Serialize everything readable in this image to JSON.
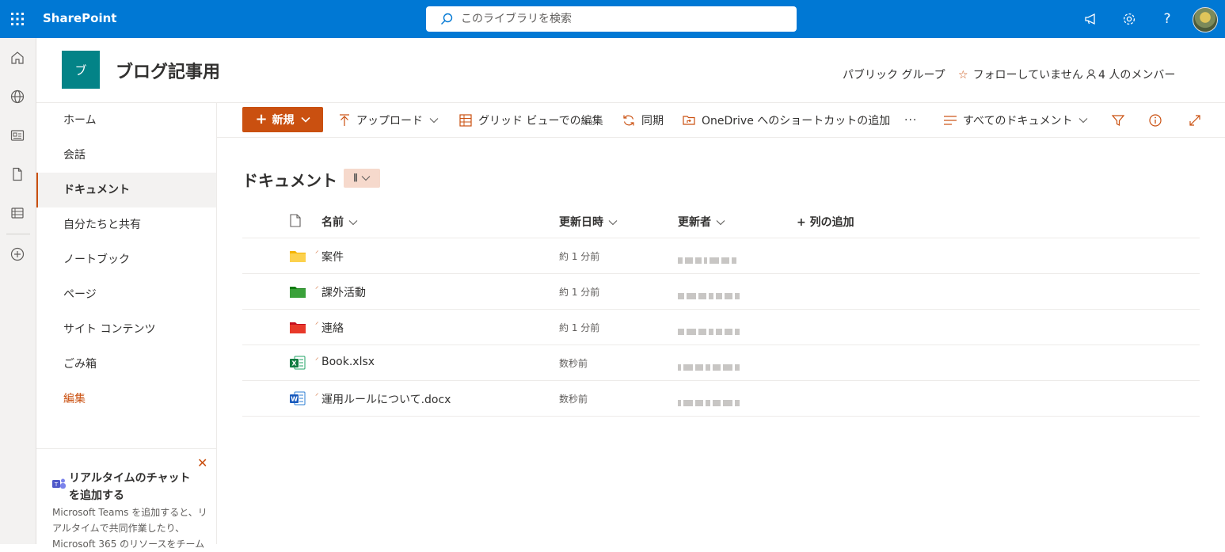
{
  "topbar": {
    "app_name": "SharePoint",
    "search_placeholder": "このライブラリを検索",
    "accent": "#0078d4"
  },
  "rail": {
    "icons": [
      "home-icon",
      "globe-icon",
      "news-icon",
      "document-icon",
      "list-icon",
      "add-icon"
    ]
  },
  "site": {
    "logo_letter": "ブ",
    "title": "ブログ記事用",
    "group_type": "パブリック グループ",
    "follow": "フォローしていません",
    "members": "4 人のメンバー"
  },
  "nav": {
    "items": [
      {
        "label": "ホーム"
      },
      {
        "label": "会話"
      },
      {
        "label": "ドキュメント"
      },
      {
        "label": "自分たちと共有"
      },
      {
        "label": "ノートブック"
      },
      {
        "label": "ページ"
      },
      {
        "label": "サイト コンテンツ"
      },
      {
        "label": "ごみ箱"
      },
      {
        "label": "編集"
      }
    ],
    "active_index": 2
  },
  "teams_card": {
    "title": "リアルタイムのチャットを追加する",
    "body": "Microsoft Teams を追加すると、リアルタイムで共同作業したり、Microsoft 365 のリソースをチーム"
  },
  "commands": {
    "new": "新規",
    "upload": "アップロード",
    "grid": "グリッド ビューでの編集",
    "sync": "同期",
    "shortcut": "OneDrive へのショートカットの追加",
    "more": "···",
    "view": "すべてのドキュメント",
    "accent": "#ca5010"
  },
  "library": {
    "title": "ドキュメント",
    "columns": {
      "name": "名前",
      "modified": "更新日時",
      "modified_by": "更新者",
      "add_column": "+ 列の追加"
    },
    "rows": [
      {
        "name": "案件",
        "type": "folder-yellow",
        "modified": "約 1 分前"
      },
      {
        "name": "課外活動",
        "type": "folder-green",
        "modified": "約 1 分前"
      },
      {
        "name": "連絡",
        "type": "folder-red",
        "modified": "約 1 分前"
      },
      {
        "name": "Book.xlsx",
        "type": "excel",
        "modified": "数秒前"
      },
      {
        "name": "運用ルールについて.docx",
        "type": "word",
        "modified": "数秒前"
      }
    ]
  }
}
